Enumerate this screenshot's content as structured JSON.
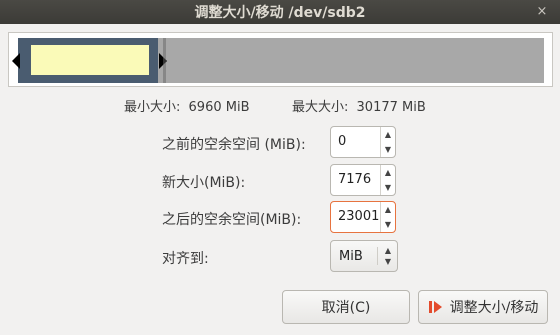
{
  "dialog": {
    "title": "调整大小/移动 /dev/sdb2",
    "close_symbol": "×"
  },
  "colors": {
    "partition_fill": "#fafab8",
    "partition_border": "#4a5c70",
    "unallocated": "#a8a8a8",
    "focus": "#e7733f",
    "apply_icon": "#e34b2c"
  },
  "info": {
    "min_label": "最小大小:",
    "min_value": "6960 MiB",
    "max_label": "最大大小:",
    "max_value": "30177 MiB"
  },
  "fields": {
    "free_before": {
      "label": "之前的空余空间 (MiB):",
      "value": "0"
    },
    "new_size": {
      "label": "新大小(MiB):",
      "value": "7176"
    },
    "free_after": {
      "label": "之后的空余空间(MiB):",
      "value": "23001"
    },
    "align": {
      "label": "对齐到:",
      "value": "MiB"
    }
  },
  "buttons": {
    "cancel": "取消(C)",
    "apply": "调整大小/移动"
  },
  "icons": {
    "close": "close-icon",
    "spin_up": "chevron-up-icon",
    "spin_down": "chevron-down-icon",
    "apply": "resize-move-icon"
  }
}
